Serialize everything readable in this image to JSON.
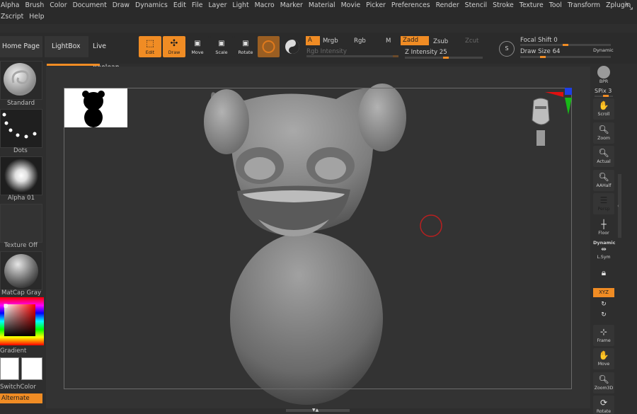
{
  "menubar": {
    "row1": [
      "Alpha",
      "Brush",
      "Color",
      "Document",
      "Draw",
      "Dynamics",
      "Edit",
      "File",
      "Layer",
      "Light",
      "Macro",
      "Marker",
      "Material",
      "Movie",
      "Picker",
      "Preferences",
      "Render",
      "Stencil",
      "Stroke",
      "Texture",
      "Tool",
      "Transform",
      "Zplugin"
    ],
    "row2": [
      "Zscript",
      "Help"
    ]
  },
  "nav": {
    "home_page": "Home Page",
    "lightbox": "LightBox",
    "live_boolean": "Live Boolean"
  },
  "toolbar": {
    "edit": "Edit",
    "draw": "Draw",
    "move": "Move",
    "scale": "Scale",
    "rotate": "Rotate",
    "a_label": "A",
    "mrgb": "Mrgb",
    "rgb": "Rgb",
    "m": "M",
    "rgb_intensity": "Rgb Intensity",
    "zadd": "Zadd",
    "zsub": "Zsub",
    "zcut": "Zcut",
    "z_intensity_label": "Z Intensity",
    "z_intensity_value": "25",
    "focal_shift_label": "Focal Shift",
    "focal_shift_value": "0",
    "draw_size_label": "Draw Size",
    "draw_size_value": "64",
    "dynamic": "Dynamic",
    "lazy_letter": "S"
  },
  "left_shelf": {
    "brush": "Standard",
    "stroke": "Dots",
    "alpha": "Alpha 01",
    "texture": "Texture Off",
    "material": "MatCap Gray",
    "gradient": "Gradient",
    "switch_color": "SwitchColor",
    "alternate": "Alternate"
  },
  "right_shelf": {
    "bpr": "BPR",
    "spix_label": "SPix",
    "spix_value": "3",
    "scroll": "Scroll",
    "zoom": "Zoom",
    "actual": "Actual",
    "aahalf": "AAHalf",
    "persp": "Persp",
    "floor": "Floor",
    "dynamic": "Dynamic",
    "lsym": "L.Sym",
    "xyz": "XYZ",
    "frame": "Frame",
    "move": "Move",
    "zoom3d": "Zoom3D",
    "rotate": "Rotate"
  },
  "colors": {
    "accent": "#f08c24",
    "background": "#2e2e2e",
    "canvas": "#333333"
  }
}
